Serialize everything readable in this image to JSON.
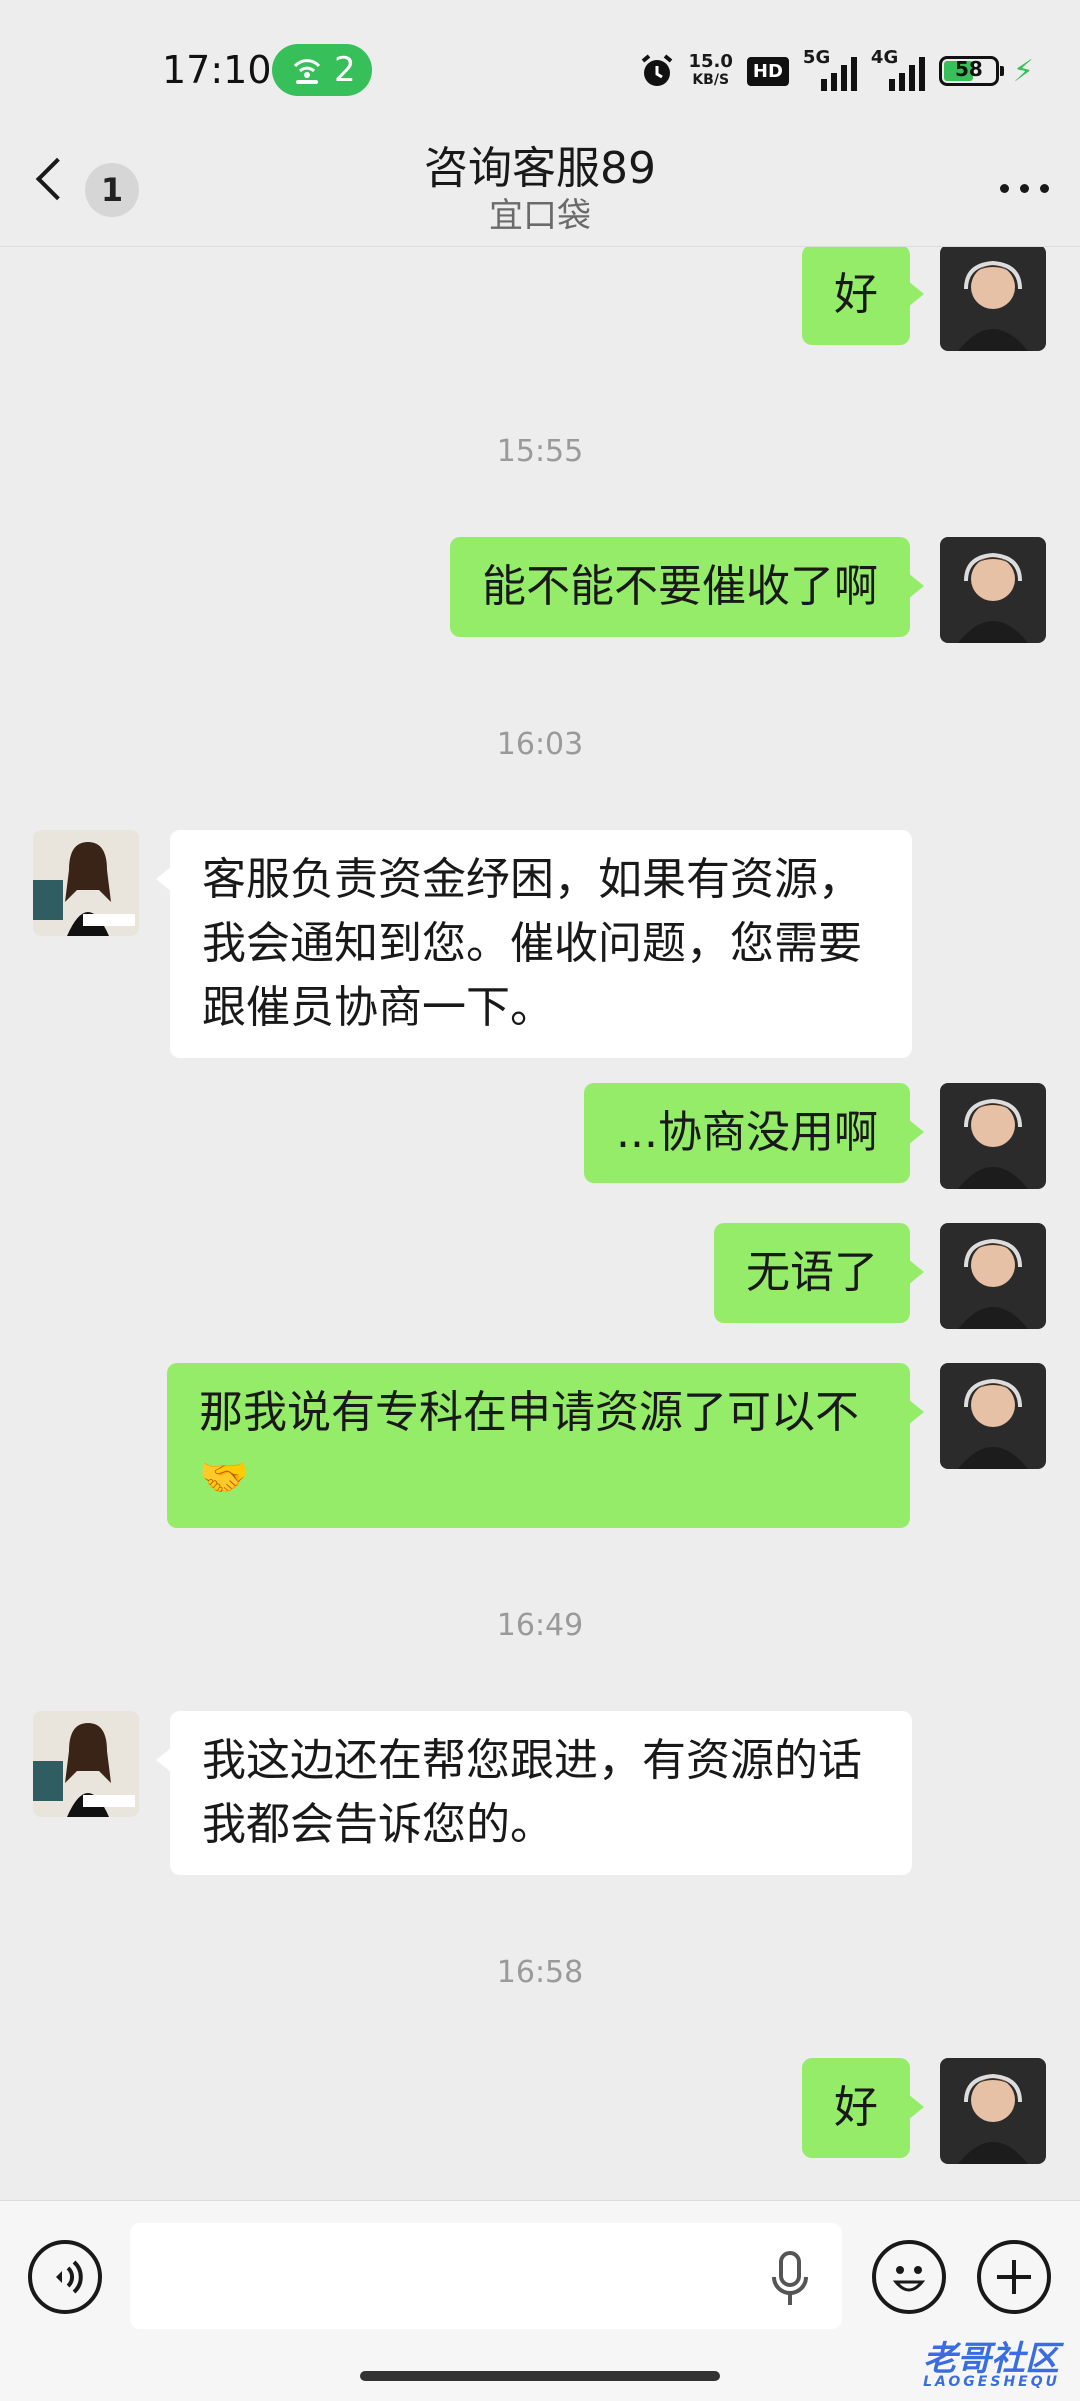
{
  "status_bar": {
    "time": "17:10",
    "hotspot_count": "2",
    "net_speed_value": "15.0",
    "net_speed_unit": "KB/S",
    "hd_label": "HD",
    "sim1_label": "5G",
    "sim2_label": "4G",
    "battery_level": "58",
    "battery_fraction": 0.58,
    "charging": true
  },
  "header": {
    "title": "咨询客服89",
    "subtitle": "宜口袋",
    "unread_count": "1"
  },
  "messages": [
    {
      "type": "out",
      "text": "好"
    },
    {
      "type": "time",
      "text": "15:55"
    },
    {
      "type": "out",
      "text": "能不能不要催收了啊"
    },
    {
      "type": "time",
      "text": "16:03"
    },
    {
      "type": "in",
      "line1": "客服负责资金纾困，如果有资源，",
      "line2": "我会通知到您。催收问题，您需要",
      "line3": "跟催员协商一下。"
    },
    {
      "type": "out",
      "text": "...协商没用啊"
    },
    {
      "type": "out",
      "text": "无语了"
    },
    {
      "type": "out",
      "line1": "那我说有专科在申请资源了可以不",
      "emoji": "🤝"
    },
    {
      "type": "time",
      "text": "16:49"
    },
    {
      "type": "in",
      "line1": "我这边还在帮您跟进，有资源的话",
      "line2": "我都会告诉您的。"
    },
    {
      "type": "time",
      "text": "16:58"
    },
    {
      "type": "out",
      "text": "好"
    }
  ],
  "input": {
    "value": "",
    "placeholder": ""
  },
  "watermark": {
    "text": "老哥社区",
    "sub": "LAOGESHEQU"
  },
  "colors": {
    "background": "#ededed",
    "outgoing_bubble": "#95ec69",
    "incoming_bubble": "#ffffff",
    "hotspot_badge": "#37c05a"
  },
  "icons": [
    "back-chevron-icon",
    "more-icon",
    "alarm-icon",
    "hotspot-icon",
    "signal-icon",
    "battery-icon",
    "charging-icon",
    "voice-icon",
    "microphone-icon",
    "emoji-icon",
    "plus-icon",
    "handshake-emoji"
  ]
}
